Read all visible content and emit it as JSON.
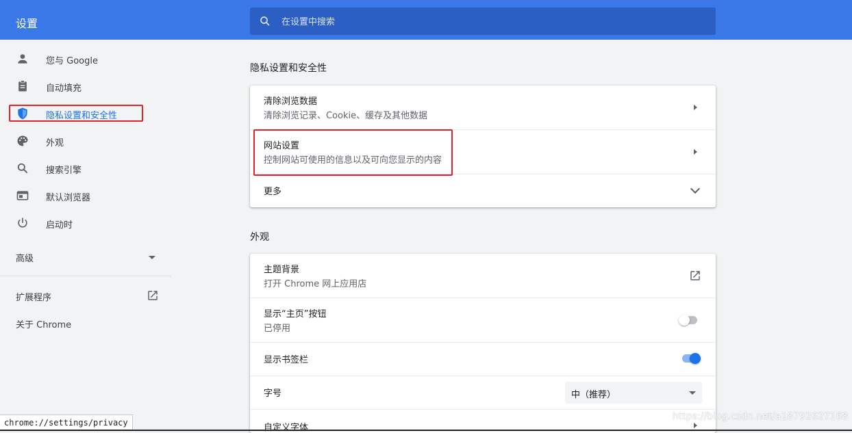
{
  "header": {
    "title": "设置",
    "search_placeholder": "在设置中搜索"
  },
  "sidebar": {
    "items": [
      {
        "label": "您与 Google",
        "icon": "person-icon"
      },
      {
        "label": "自动填充",
        "icon": "clipboard-icon"
      },
      {
        "label": "隐私设置和安全性",
        "icon": "shield-icon",
        "active": true
      },
      {
        "label": "外观",
        "icon": "palette-icon"
      },
      {
        "label": "搜索引擎",
        "icon": "search-icon"
      },
      {
        "label": "默认浏览器",
        "icon": "browser-icon"
      },
      {
        "label": "启动时",
        "icon": "power-icon"
      }
    ],
    "advanced_label": "高级",
    "extensions_label": "扩展程序",
    "about_label": "关于 Chrome"
  },
  "privacy": {
    "section_title": "隐私设置和安全性",
    "clear_title": "清除浏览数据",
    "clear_desc": "清除浏览记录、Cookie、缓存及其他数据",
    "site_title": "网站设置",
    "site_desc": "控制网站可使用的信息以及可向您显示的内容",
    "more_label": "更多"
  },
  "appearance": {
    "section_title": "外观",
    "theme_title": "主题背景",
    "theme_desc": "打开 Chrome 网上应用店",
    "home_title": "显示“主页”按钮",
    "home_desc": "已停用",
    "home_enabled": false,
    "bookmarks_title": "显示书签栏",
    "bookmarks_enabled": true,
    "font_size_label": "字号",
    "font_size_value": "中（推荐）",
    "custom_font_label": "自定义字体"
  },
  "status_url": "chrome://settings/privacy",
  "watermark": "https://blog.csdn.net/a18792627168",
  "colors": {
    "header_blue": "#3b78e7",
    "search_bg": "#2c5fc4",
    "accent": "#1a73e8",
    "highlight_red": "#e0232b"
  }
}
